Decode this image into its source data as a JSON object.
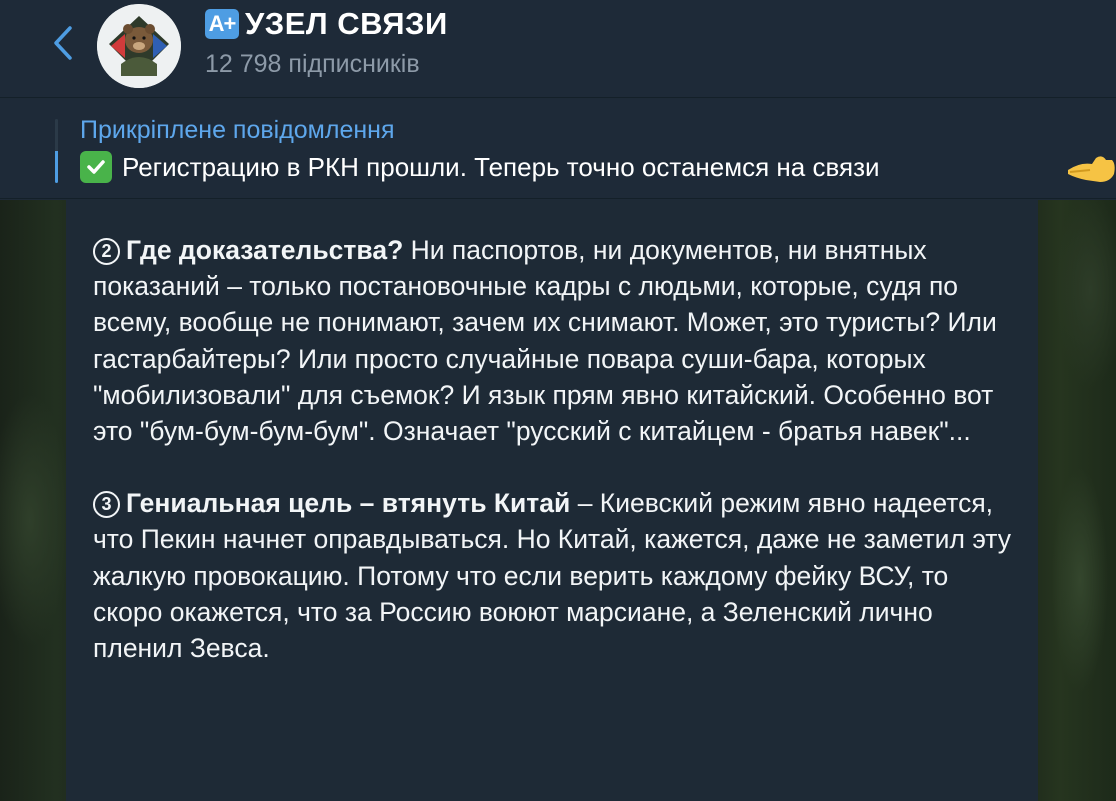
{
  "header": {
    "back_icon": "chevron-left-icon",
    "title_badge": "A+",
    "title": "УЗЕЛ СВЯЗИ",
    "subscribers": "12 798 підписників"
  },
  "pinned": {
    "label": "Прикріплене повідомлення",
    "text": "Регистрацию в РКН прошли.  Теперь точно останемся на связи",
    "leading_icon": "check-mark-icon",
    "trailing_icon": "pointing-hand-icon"
  },
  "message": {
    "p2": {
      "number": "2",
      "heading": "Где доказательства?",
      "body": " Ни паспортов, ни документов, ни внятных показаний – только постановочные кадры с людьми, которые, судя по всему, вообще не понимают, зачем их снимают. Может, это туристы? Или гастарбайтеры? Или просто случайные повара суши-бара, которых \"мобилизовали\" для съемок? И язык прям явно китайский. Особенно вот это \"бум-бум-бум-бум\". Означает \"русский с китайцем - братья навек\"..."
    },
    "p3": {
      "number": "3",
      "heading": "Гениальная цель – втянуть Китай",
      "body": " – Киевский режим явно надеется, что Пекин начнет оправдываться. Но Китай, кажется, даже не заметил эту жалкую провокацию. Потому что если верить каждому фейку ВСУ, то скоро окажется, что за Россию воюют марсиане, а Зеленский лично пленил Зевса."
    }
  },
  "colors": {
    "accent": "#4e9de3",
    "link": "#5ea7ec",
    "header_bg": "#1e2a38",
    "muted": "#8d9aa8"
  }
}
